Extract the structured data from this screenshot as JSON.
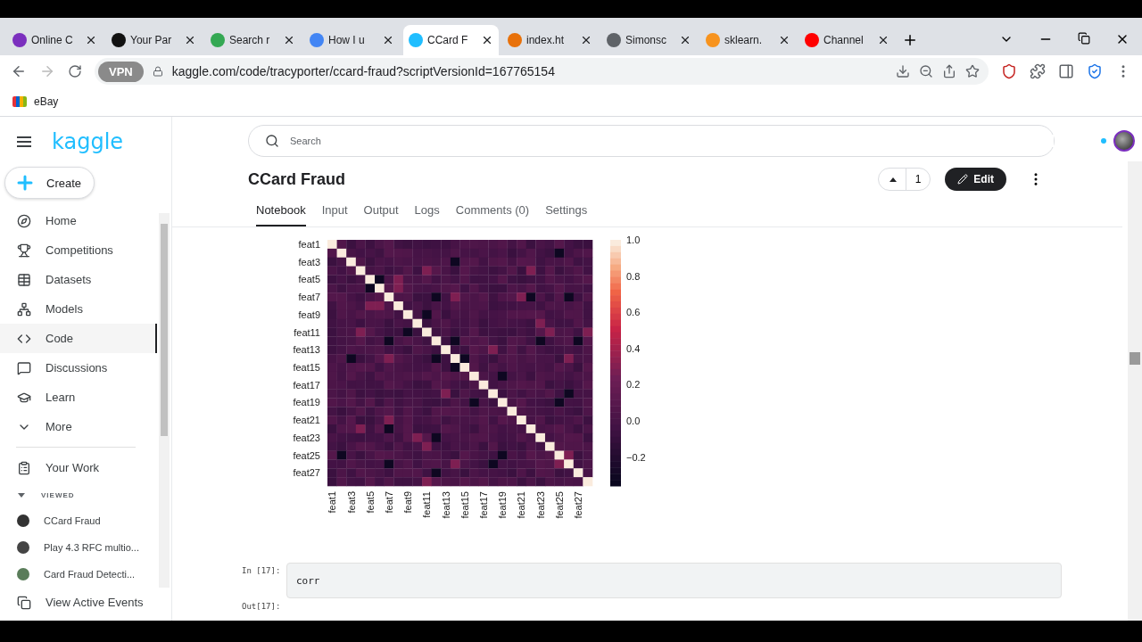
{
  "browser": {
    "tabs": [
      {
        "title": "Online C",
        "selected": false,
        "color": "#7b2fbe"
      },
      {
        "title": "Your Par",
        "selected": false,
        "color": "#111111"
      },
      {
        "title": "Search r",
        "selected": false,
        "color": "#34a853"
      },
      {
        "title": "How I u",
        "selected": false,
        "color": "#4285f4"
      },
      {
        "title": "CCard F",
        "selected": true,
        "color": "#20beff"
      },
      {
        "title": "index.ht",
        "selected": false,
        "color": "#e8710a"
      },
      {
        "title": "Simonsc",
        "selected": false,
        "color": "#5f6368"
      },
      {
        "title": "sklearn.",
        "selected": false,
        "color": "#f7931e"
      },
      {
        "title": "Channel",
        "selected": false,
        "color": "#ff0000"
      }
    ],
    "vpn_badge": "VPN",
    "url": "kaggle.com/code/tracyporter/ccard-fraud?scriptVersionId=167765154",
    "bookmarks": [
      "eBay"
    ]
  },
  "sidebar": {
    "logo": "kaggle",
    "create_button": "Create",
    "nav_items": [
      {
        "label": "Home",
        "selected": false
      },
      {
        "label": "Competitions",
        "selected": false
      },
      {
        "label": "Datasets",
        "selected": false
      },
      {
        "label": "Models",
        "selected": false
      },
      {
        "label": "Code",
        "selected": true
      },
      {
        "label": "Discussions",
        "selected": false
      },
      {
        "label": "Learn",
        "selected": false
      },
      {
        "label": "More",
        "selected": false
      }
    ],
    "your_work": "Your Work",
    "viewed": {
      "heading": "VIEWED",
      "expanded": true,
      "items": [
        {
          "label": "CCard Fraud",
          "color": "#333333"
        },
        {
          "label": "Play 4.3 RFC multio...",
          "color": "#444444"
        },
        {
          "label": "Card Fraud Detecti...",
          "color": "#5a7d5a"
        }
      ]
    },
    "footer_link": "View Active Events"
  },
  "search": {
    "placeholder": "Search"
  },
  "notebook": {
    "title": "CCard Fraud",
    "votes": "1",
    "edit_button": "Edit",
    "tabs": [
      {
        "label": "Notebook",
        "selected": true
      },
      {
        "label": "Input",
        "selected": false
      },
      {
        "label": "Output",
        "selected": false
      },
      {
        "label": "Logs",
        "selected": false
      },
      {
        "label": "Comments (0)",
        "selected": false
      },
      {
        "label": "Settings",
        "selected": false
      }
    ],
    "heatmap": {
      "y_labels": [
        "feat1",
        "feat3",
        "feat5",
        "feat7",
        "feat9",
        "feat11",
        "feat13",
        "feat15",
        "feat17",
        "feat19",
        "feat21",
        "feat23",
        "feat25",
        "feat27"
      ],
      "x_labels": [
        "feat1",
        "feat3",
        "feat5",
        "feat7",
        "feat9",
        "feat11",
        "feat13",
        "feat15",
        "feat17",
        "feat19",
        "feat21",
        "feat23",
        "feat25",
        "feat27"
      ],
      "colorbar_ticks": [
        "1.0",
        "0.8",
        "0.6",
        "0.4",
        "0.2",
        "0.0",
        "−0.2"
      ]
    },
    "cells": [
      {
        "kind": "input",
        "prompt": "In [17]:",
        "code": "corr"
      },
      {
        "kind": "output",
        "prompt": "Out[17]:"
      }
    ]
  }
}
